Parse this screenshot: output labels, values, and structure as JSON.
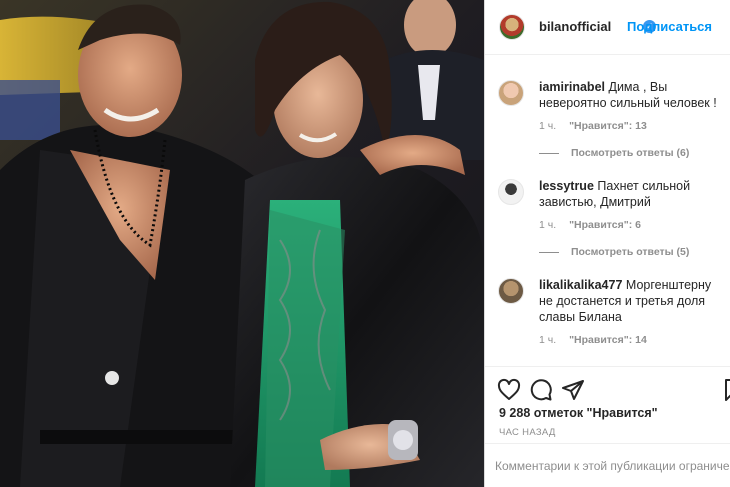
{
  "post": {
    "username": "bilanofficial",
    "verified": true,
    "follow_label": "Подписаться",
    "dot": "•"
  },
  "comments": [
    {
      "username": "iamirinabel",
      "text": "Дима , Вы невероятно сильный человек !",
      "time": "1 ч.",
      "likes": "\"Нравится\": 13",
      "replies": "Посмотреть ответы (6)"
    },
    {
      "username": "lessytrue",
      "text": "Пахнет сильной завистью, Дмитрий",
      "time": "1 ч.",
      "likes": "\"Нравится\": 6",
      "replies": "Посмотреть ответы (5)"
    },
    {
      "username": "likalikalika477",
      "text": "Моргенштерну не достанется и третья доля славы Билана",
      "time": "1 ч.",
      "likes": "\"Нравится\": 14"
    }
  ],
  "stats": {
    "likes_total": "9 288 отметок \"Нравится\"",
    "time_ago": "ЧАС НАЗАД"
  },
  "comments_disabled": "Комментарии к этой публикации ограничены.",
  "icons": [
    "heart-icon",
    "comment-icon",
    "share-icon",
    "bookmark-icon",
    "verified-icon"
  ],
  "colors": {
    "accent": "#0095f6",
    "verified": "#3897f0",
    "muted": "#8e8e8e",
    "text": "#262626"
  }
}
